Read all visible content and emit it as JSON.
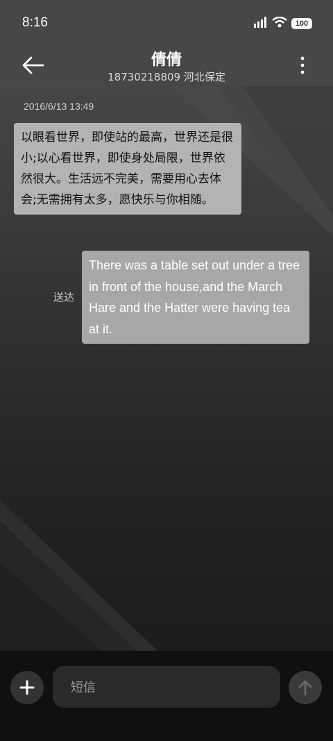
{
  "status_bar": {
    "time": "8:16",
    "battery": "100"
  },
  "header": {
    "contact_name": "倩倩",
    "contact_detail": "18730218809 河北保定"
  },
  "conversation": {
    "timestamp": "2016/6/13 13:49",
    "incoming_message": "以眼看世界，即使站的最高，世界还是很小;以心看世界，即使身处局限，世界依然很大。生活远不完美，需要用心去体会;无需拥有太多，愿快乐与你相随。",
    "outgoing_message": "There was a table set out under a tree in front of the house,and the March Hare and the Hatter were having tea at it.",
    "outgoing_status": "送达"
  },
  "composer": {
    "placeholder": "短信"
  },
  "icons": {
    "back": "arrow-left-icon",
    "more": "vertical-dots-icon",
    "add": "plus-icon",
    "send": "arrow-up-icon",
    "signal": "signal-icon",
    "wifi": "wifi-icon",
    "battery": "battery-icon"
  }
}
